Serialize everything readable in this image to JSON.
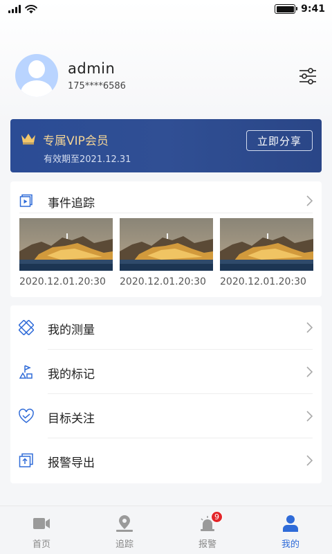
{
  "status_bar": {
    "time": "9:41"
  },
  "profile": {
    "username": "admin",
    "phone": "175****6586"
  },
  "vip": {
    "title": "专属VIP会员",
    "expiry": "有效期至2021.12.31",
    "share_label": "立即分享",
    "accent_color": "#f3d496"
  },
  "events": {
    "title": "事件追踪",
    "items": [
      {
        "date": "2020.12.01.20:30"
      },
      {
        "date": "2020.12.01.20:30"
      },
      {
        "date": "2020.12.01.20:30"
      }
    ]
  },
  "menu": {
    "items": [
      {
        "label": "我的测量",
        "icon": "measure-icon"
      },
      {
        "label": "我的标记",
        "icon": "marker-icon"
      },
      {
        "label": "目标关注",
        "icon": "heart-shield-icon"
      },
      {
        "label": "报警导出",
        "icon": "export-icon"
      }
    ]
  },
  "tabs": [
    {
      "label": "首页",
      "icon": "camera-icon"
    },
    {
      "label": "追踪",
      "icon": "location-pin-icon"
    },
    {
      "label": "报警",
      "icon": "alarm-light-icon",
      "badge": "9"
    },
    {
      "label": "我的",
      "icon": "person-icon",
      "active": true
    }
  ],
  "colors": {
    "primary": "#2f6bd8",
    "vip_bg": "#2b4c95",
    "badge": "#e3262a"
  }
}
